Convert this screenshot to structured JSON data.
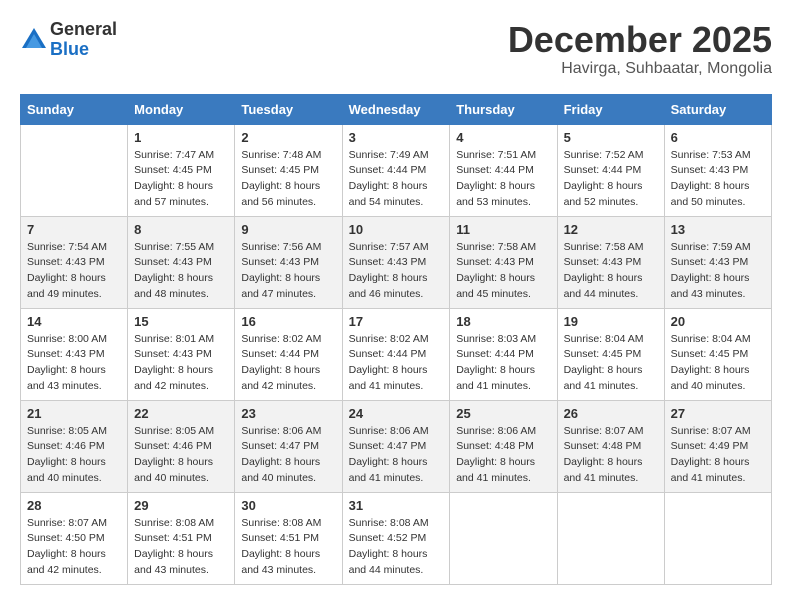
{
  "logo": {
    "general": "General",
    "blue": "Blue"
  },
  "header": {
    "month": "December 2025",
    "location": "Havirga, Suhbaatar, Mongolia"
  },
  "weekdays": [
    "Sunday",
    "Monday",
    "Tuesday",
    "Wednesday",
    "Thursday",
    "Friday",
    "Saturday"
  ],
  "weeks": [
    [
      {
        "day": "",
        "info": ""
      },
      {
        "day": "1",
        "info": "Sunrise: 7:47 AM\nSunset: 4:45 PM\nDaylight: 8 hours\nand 57 minutes."
      },
      {
        "day": "2",
        "info": "Sunrise: 7:48 AM\nSunset: 4:45 PM\nDaylight: 8 hours\nand 56 minutes."
      },
      {
        "day": "3",
        "info": "Sunrise: 7:49 AM\nSunset: 4:44 PM\nDaylight: 8 hours\nand 54 minutes."
      },
      {
        "day": "4",
        "info": "Sunrise: 7:51 AM\nSunset: 4:44 PM\nDaylight: 8 hours\nand 53 minutes."
      },
      {
        "day": "5",
        "info": "Sunrise: 7:52 AM\nSunset: 4:44 PM\nDaylight: 8 hours\nand 52 minutes."
      },
      {
        "day": "6",
        "info": "Sunrise: 7:53 AM\nSunset: 4:43 PM\nDaylight: 8 hours\nand 50 minutes."
      }
    ],
    [
      {
        "day": "7",
        "info": "Sunrise: 7:54 AM\nSunset: 4:43 PM\nDaylight: 8 hours\nand 49 minutes."
      },
      {
        "day": "8",
        "info": "Sunrise: 7:55 AM\nSunset: 4:43 PM\nDaylight: 8 hours\nand 48 minutes."
      },
      {
        "day": "9",
        "info": "Sunrise: 7:56 AM\nSunset: 4:43 PM\nDaylight: 8 hours\nand 47 minutes."
      },
      {
        "day": "10",
        "info": "Sunrise: 7:57 AM\nSunset: 4:43 PM\nDaylight: 8 hours\nand 46 minutes."
      },
      {
        "day": "11",
        "info": "Sunrise: 7:58 AM\nSunset: 4:43 PM\nDaylight: 8 hours\nand 45 minutes."
      },
      {
        "day": "12",
        "info": "Sunrise: 7:58 AM\nSunset: 4:43 PM\nDaylight: 8 hours\nand 44 minutes."
      },
      {
        "day": "13",
        "info": "Sunrise: 7:59 AM\nSunset: 4:43 PM\nDaylight: 8 hours\nand 43 minutes."
      }
    ],
    [
      {
        "day": "14",
        "info": "Sunrise: 8:00 AM\nSunset: 4:43 PM\nDaylight: 8 hours\nand 43 minutes."
      },
      {
        "day": "15",
        "info": "Sunrise: 8:01 AM\nSunset: 4:43 PM\nDaylight: 8 hours\nand 42 minutes."
      },
      {
        "day": "16",
        "info": "Sunrise: 8:02 AM\nSunset: 4:44 PM\nDaylight: 8 hours\nand 42 minutes."
      },
      {
        "day": "17",
        "info": "Sunrise: 8:02 AM\nSunset: 4:44 PM\nDaylight: 8 hours\nand 41 minutes."
      },
      {
        "day": "18",
        "info": "Sunrise: 8:03 AM\nSunset: 4:44 PM\nDaylight: 8 hours\nand 41 minutes."
      },
      {
        "day": "19",
        "info": "Sunrise: 8:04 AM\nSunset: 4:45 PM\nDaylight: 8 hours\nand 41 minutes."
      },
      {
        "day": "20",
        "info": "Sunrise: 8:04 AM\nSunset: 4:45 PM\nDaylight: 8 hours\nand 40 minutes."
      }
    ],
    [
      {
        "day": "21",
        "info": "Sunrise: 8:05 AM\nSunset: 4:46 PM\nDaylight: 8 hours\nand 40 minutes."
      },
      {
        "day": "22",
        "info": "Sunrise: 8:05 AM\nSunset: 4:46 PM\nDaylight: 8 hours\nand 40 minutes."
      },
      {
        "day": "23",
        "info": "Sunrise: 8:06 AM\nSunset: 4:47 PM\nDaylight: 8 hours\nand 40 minutes."
      },
      {
        "day": "24",
        "info": "Sunrise: 8:06 AM\nSunset: 4:47 PM\nDaylight: 8 hours\nand 41 minutes."
      },
      {
        "day": "25",
        "info": "Sunrise: 8:06 AM\nSunset: 4:48 PM\nDaylight: 8 hours\nand 41 minutes."
      },
      {
        "day": "26",
        "info": "Sunrise: 8:07 AM\nSunset: 4:48 PM\nDaylight: 8 hours\nand 41 minutes."
      },
      {
        "day": "27",
        "info": "Sunrise: 8:07 AM\nSunset: 4:49 PM\nDaylight: 8 hours\nand 41 minutes."
      }
    ],
    [
      {
        "day": "28",
        "info": "Sunrise: 8:07 AM\nSunset: 4:50 PM\nDaylight: 8 hours\nand 42 minutes."
      },
      {
        "day": "29",
        "info": "Sunrise: 8:08 AM\nSunset: 4:51 PM\nDaylight: 8 hours\nand 43 minutes."
      },
      {
        "day": "30",
        "info": "Sunrise: 8:08 AM\nSunset: 4:51 PM\nDaylight: 8 hours\nand 43 minutes."
      },
      {
        "day": "31",
        "info": "Sunrise: 8:08 AM\nSunset: 4:52 PM\nDaylight: 8 hours\nand 44 minutes."
      },
      {
        "day": "",
        "info": ""
      },
      {
        "day": "",
        "info": ""
      },
      {
        "day": "",
        "info": ""
      }
    ]
  ]
}
